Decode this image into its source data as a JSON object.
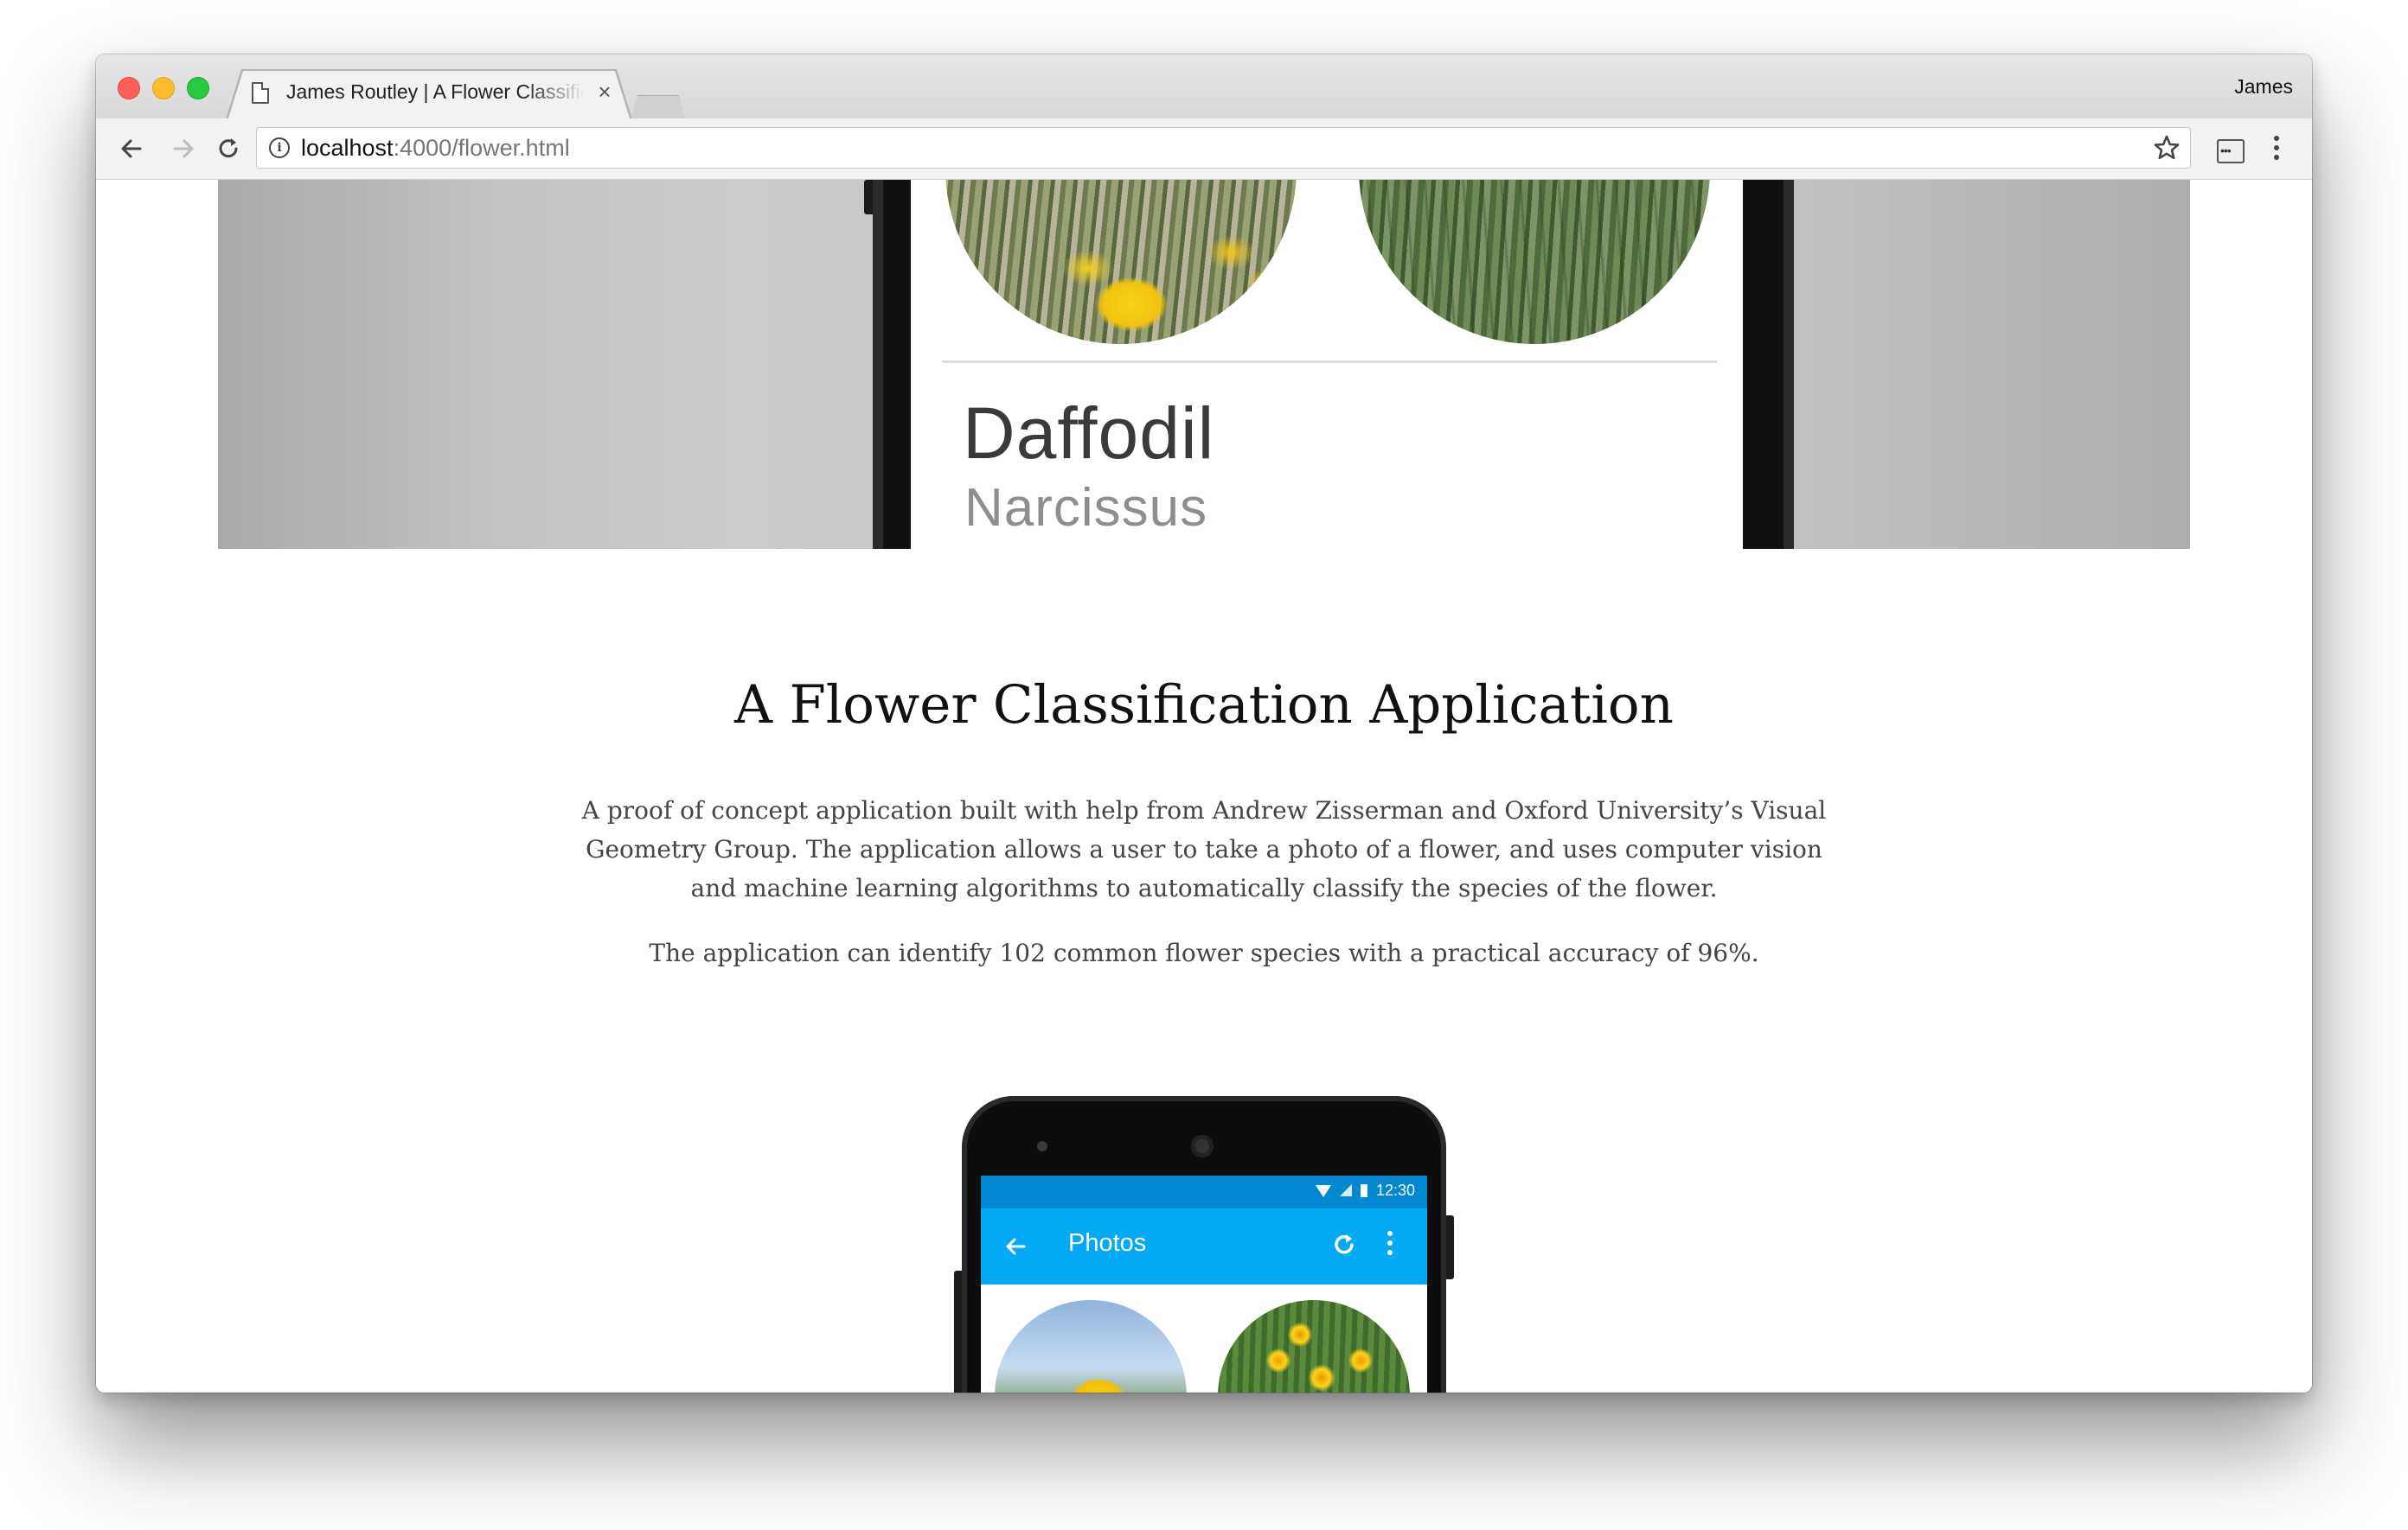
{
  "browser": {
    "tab_title": "James Routley | A Flower Classification Application",
    "tab_close": "×",
    "profile_name": "James",
    "url_host": "localhost",
    "url_rest": ":4000/flower.html",
    "icons": [
      "back-arrow-icon",
      "forward-arrow-icon",
      "reload-icon",
      "info-icon",
      "star-icon",
      "extension-icon",
      "menu-icon",
      "document-icon"
    ],
    "window_controls": {
      "close": "#fc5f57",
      "minimize": "#fdbc2e",
      "maximize": "#28c840"
    }
  },
  "hero": {
    "flower_name": "Daffodil",
    "latin_name": "Narcissus"
  },
  "page": {
    "title": "A Flower Classification Application",
    "description": "A proof of concept application built with help from Andrew Zisserman and Oxford University’s Visual Geometry Group. The application allows a user to take a photo of a flower, and uses computer vision and machine learning algorithms to automatically classify the species of the flower.",
    "accuracy": "The application can identify 102 common flower species with a practical accuracy of 96%."
  },
  "phone": {
    "status_time": "12:30",
    "app_title": "Photos",
    "colors": {
      "status_bar": "#0288d1",
      "app_bar": "#03a9f4"
    }
  }
}
